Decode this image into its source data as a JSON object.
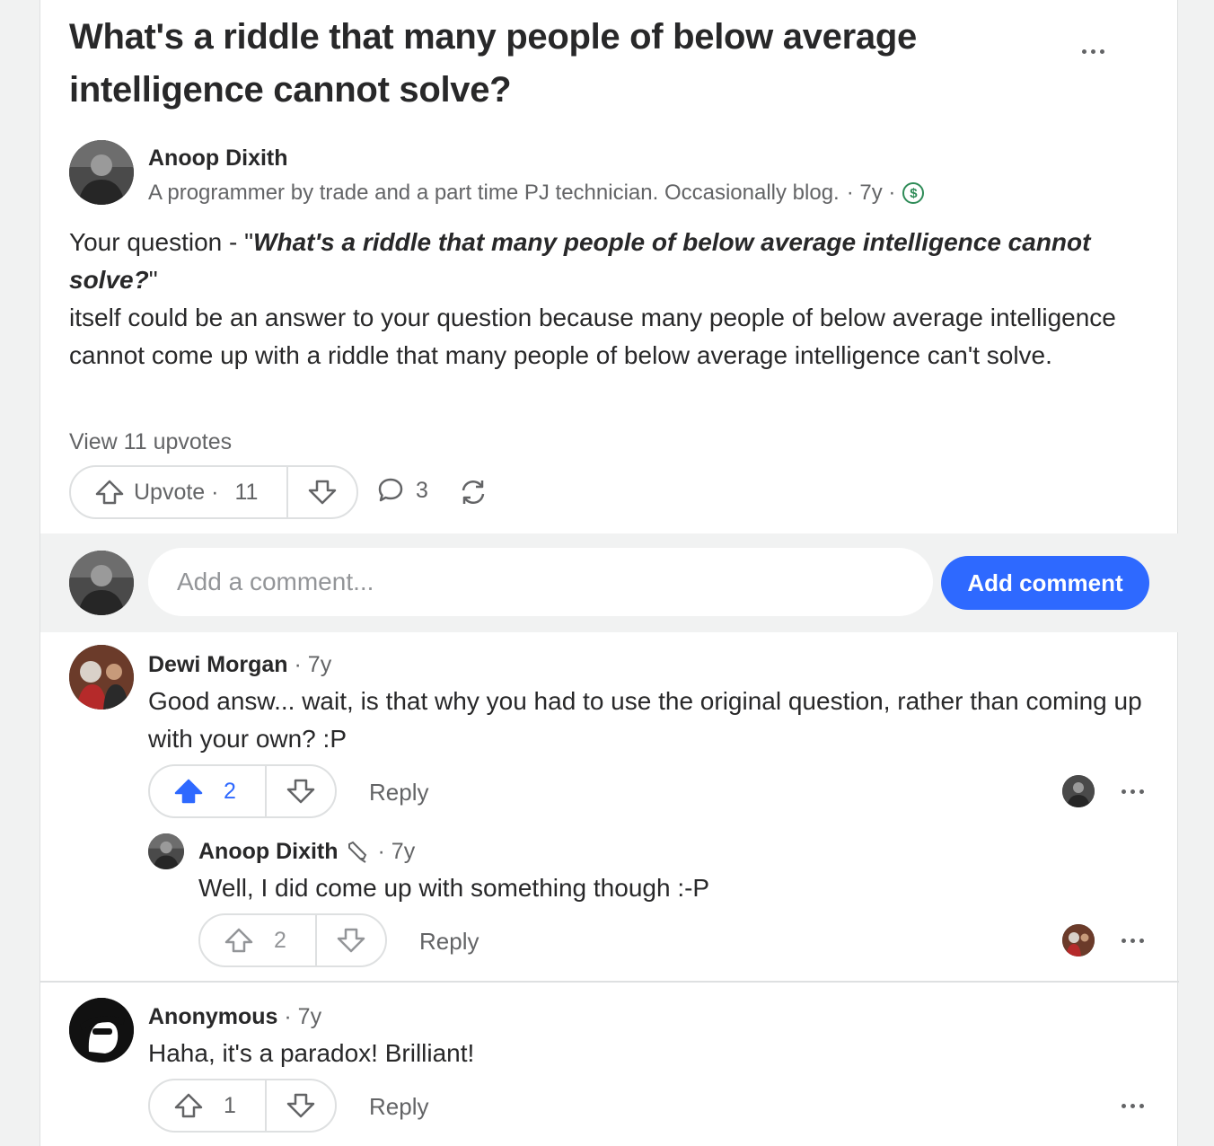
{
  "question": {
    "title": "What's a riddle that many people of below average intelligence cannot solve?"
  },
  "answer": {
    "author": "Anoop Dixith",
    "credential": "A programmer by trade and a part time PJ technician. Occasionally blog.",
    "time": "· 7y ·",
    "lead": "Your question - \"",
    "quote": "What's a riddle that many people of below average intelligence cannot solve?",
    "quote_end": "\"",
    "body": "itself could be an answer to your question because many people of below average intelligence cannot come up with a riddle that many people of below average intelligence can't solve.",
    "view_upvotes": "View 11 upvotes",
    "upvote_label": "Upvote ·",
    "upvote_count": "11",
    "comment_count": "3",
    "icons": [
      "more-icon",
      "dollar-icon",
      "upvote-icon",
      "downvote-icon",
      "comment-icon",
      "share-icon"
    ]
  },
  "comment_box": {
    "placeholder": "Add a comment...",
    "button": "Add comment"
  },
  "comments": [
    {
      "author": "Dewi Morgan",
      "time": "· 7y",
      "text": "Good answ... wait, is that why you had to use the original question, rather than coming up with your own? :P",
      "upvotes": "2",
      "reply": "Reply",
      "upvoted": true
    },
    {
      "author": "Anoop Dixith",
      "time": "· 7y",
      "text": "Well, I did come up with something though :-P",
      "upvotes": "2",
      "reply": "Reply",
      "upvoted": false
    },
    {
      "author": "Anonymous",
      "time": "· 7y",
      "text": "Haha, it's a paradox! Brilliant!",
      "upvotes": "1",
      "reply": "Reply",
      "upvoted": false
    }
  ],
  "colors": {
    "accent": "#2e69ff",
    "text": "#282829",
    "muted": "#636466",
    "border": "#dee0e1",
    "bg": "#f1f2f2"
  }
}
